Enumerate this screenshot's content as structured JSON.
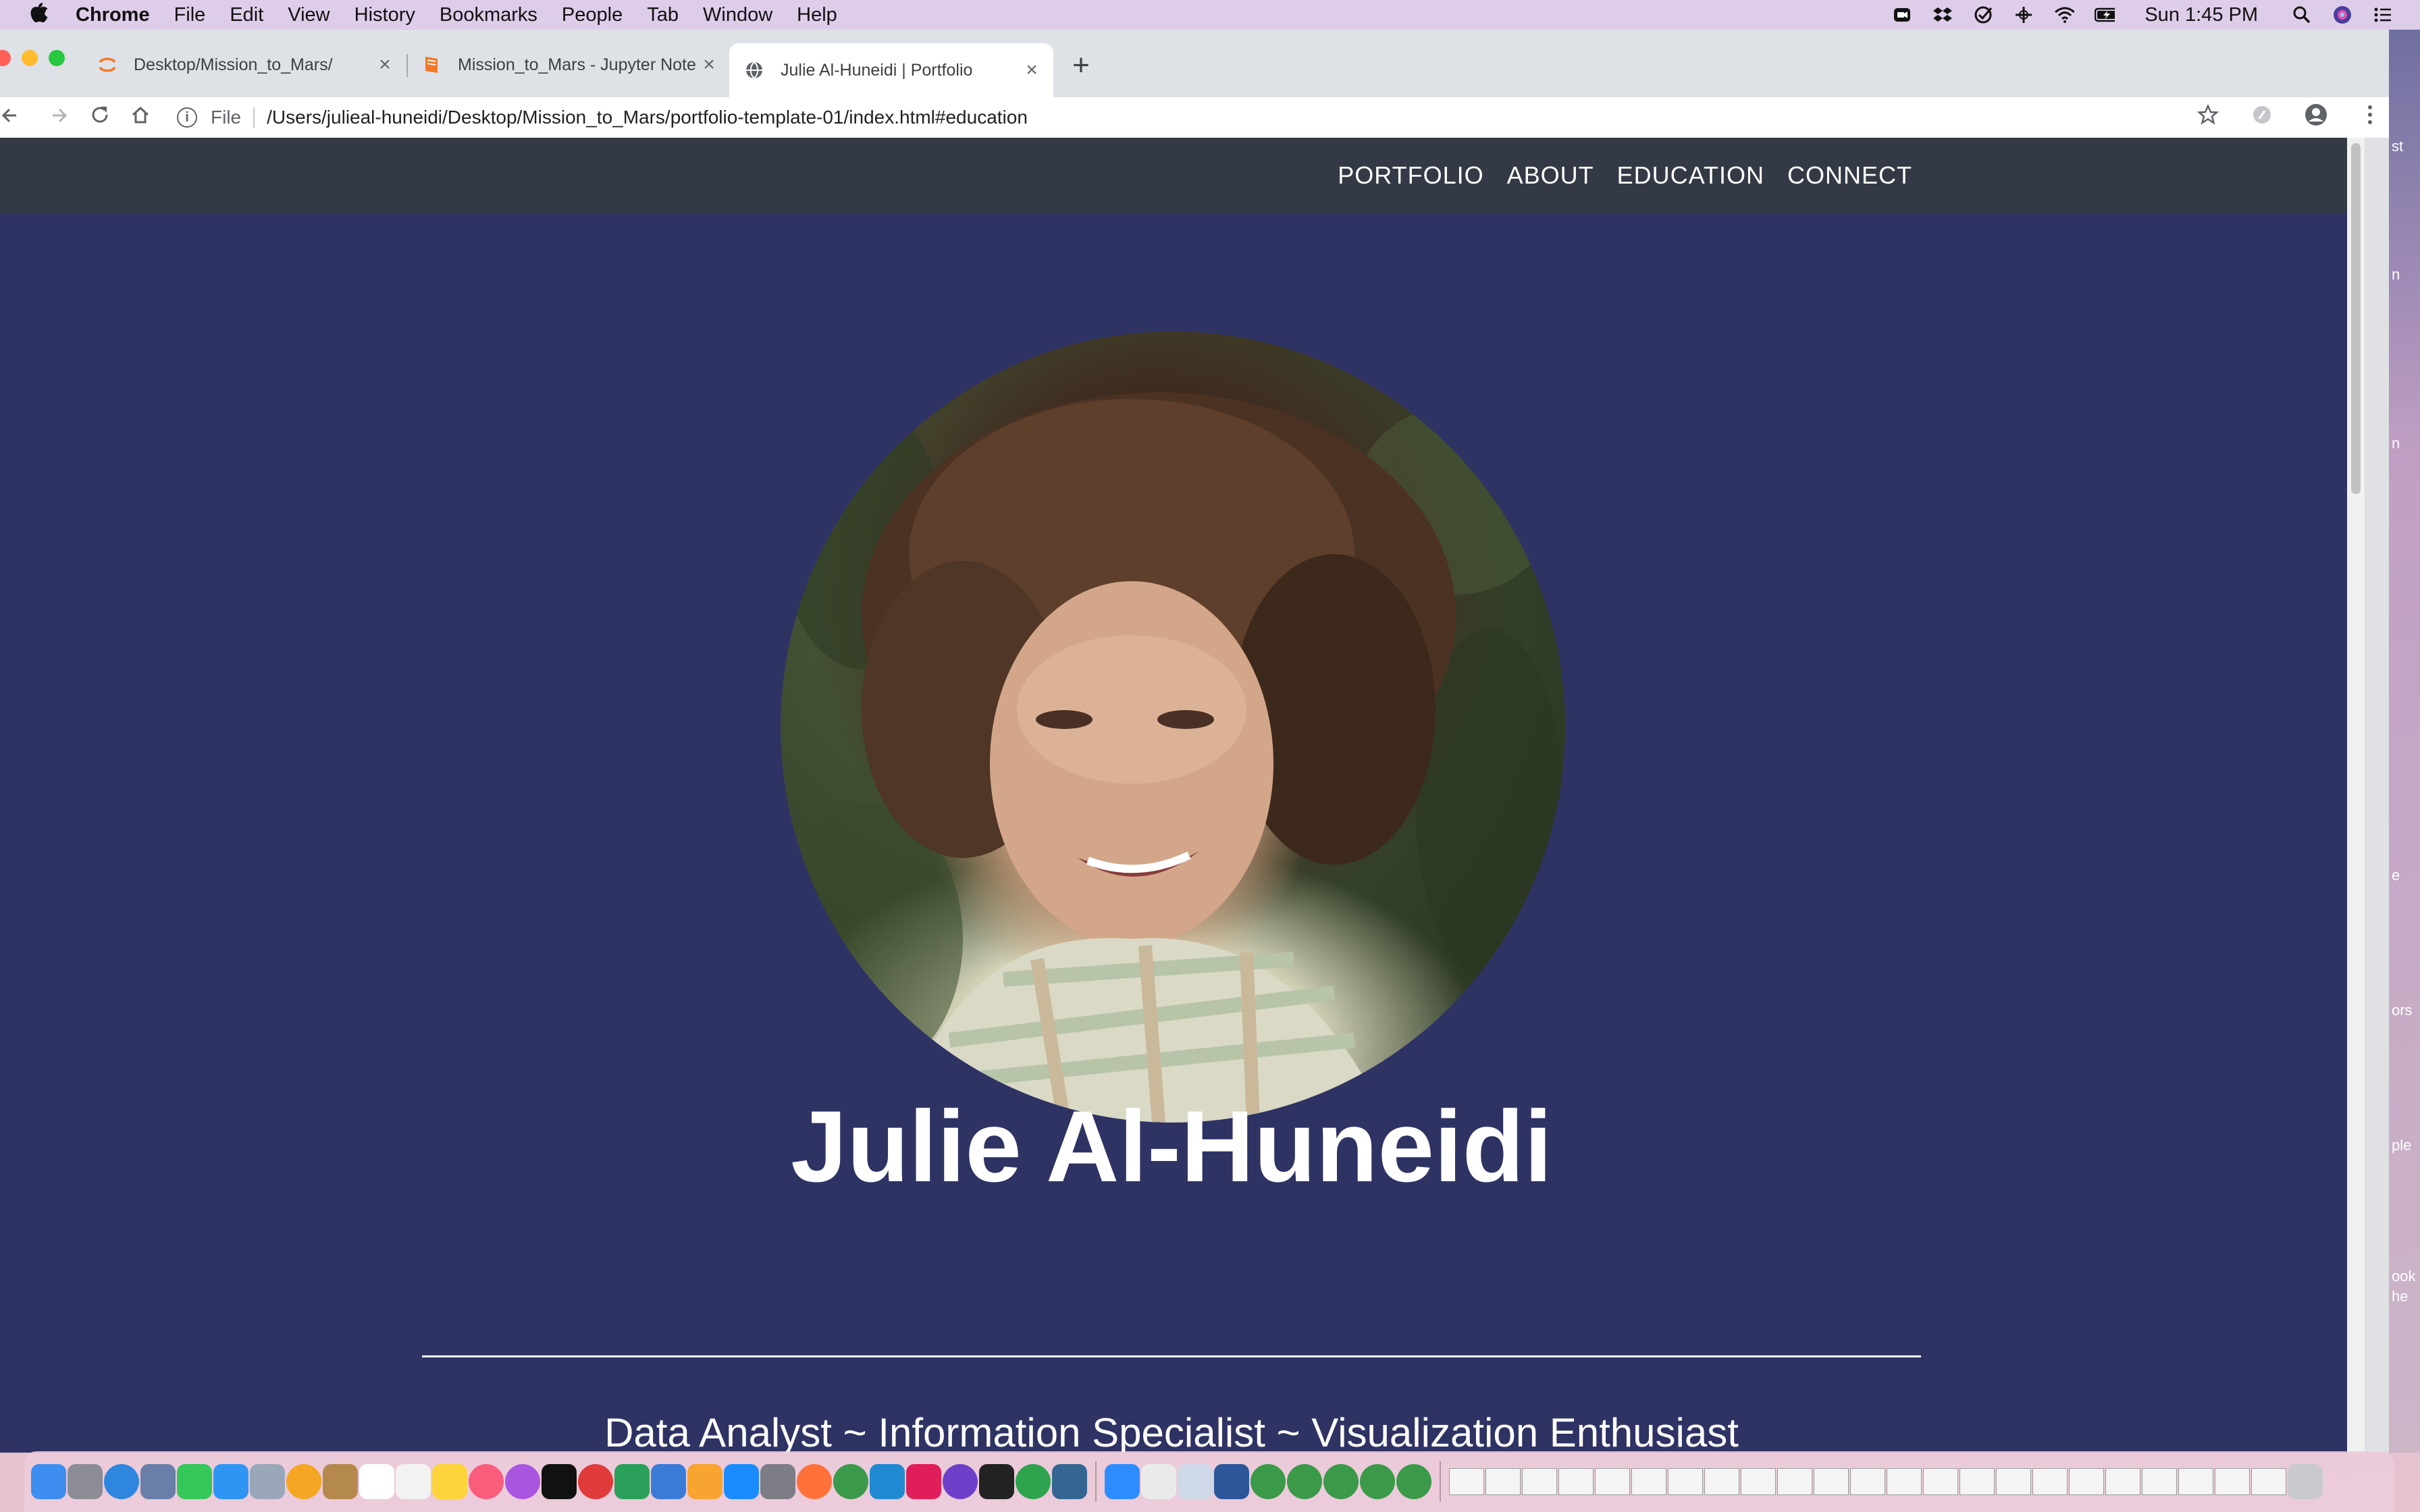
{
  "menubar": {
    "app": "Chrome",
    "items": [
      "File",
      "Edit",
      "View",
      "History",
      "Bookmarks",
      "People",
      "Tab",
      "Window",
      "Help"
    ],
    "clock": "Sun 1:45 PM",
    "status_icons": [
      "zoom-icon",
      "dropbox-icon",
      "checkmark-icon",
      "crosshair-icon",
      "wifi-icon",
      "battery-icon",
      "spotlight-icon",
      "siri-icon",
      "control-center-icon"
    ]
  },
  "tabs": [
    {
      "label": "Desktop/Mission_to_Mars/",
      "icon": "jupyter-icon",
      "active": false
    },
    {
      "label": "Mission_to_Mars - Jupyter Notebook",
      "icon": "notebook-icon",
      "active": false
    },
    {
      "label": "Julie Al-Huneidi | Portfolio",
      "icon": "globe-icon",
      "active": true
    }
  ],
  "new_tab_label": "+",
  "toolbar": {
    "info_label": "i",
    "file_label": "File",
    "url": "/Users/julieal-huneidi/Desktop/Mission_to_Mars/portfolio-template-01/index.html#education"
  },
  "site": {
    "nav": [
      "PORTFOLIO",
      "ABOUT",
      "EDUCATION",
      "CONNECT"
    ],
    "name": "Julie Al-Huneidi",
    "tagline": "Data Analyst ~ Information Specialist ~ Visualization Enthusiast"
  },
  "desktop_fragments": [
    "st",
    "n",
    "n",
    "e",
    "ors",
    "ple",
    "ook",
    "he"
  ],
  "colors": {
    "page_background": "#2e3364",
    "site_nav": "#343a45",
    "text": "#ffffff"
  }
}
